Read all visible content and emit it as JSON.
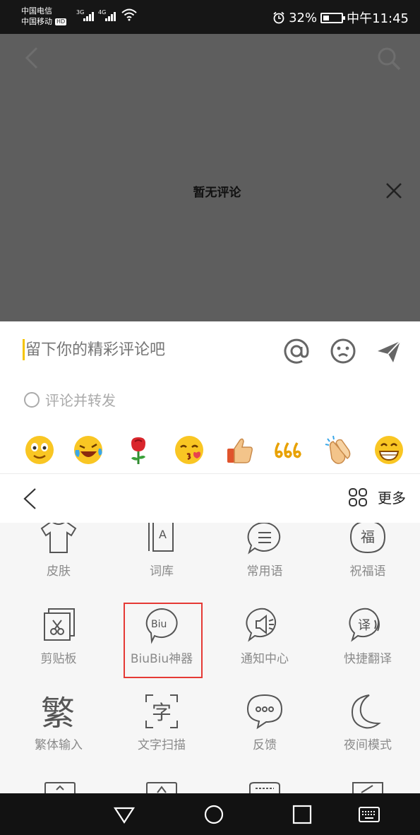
{
  "status_bar": {
    "carrier_1": "中国电信",
    "carrier_2": "中国移动",
    "hd_badge": "HD",
    "network_1": "3G",
    "network_2": "4G",
    "battery_text": "32%",
    "battery_level": 0.32,
    "time": "中午11:45"
  },
  "overlay": {
    "empty_message": "暂无评论"
  },
  "comment_box": {
    "placeholder": "留下你的精彩评论吧",
    "repost_label": "评论并转发",
    "emojis": [
      "smile-emoji",
      "laugh-cry-emoji",
      "rose-emoji",
      "kiss-emoji",
      "thumbs-up-emoji",
      "666-emoji",
      "clapping-emoji",
      "grin-emoji"
    ]
  },
  "keyboard_toolbar": {
    "more_label": "更多"
  },
  "tools": [
    {
      "label": "皮肤",
      "icon": "shirt-icon"
    },
    {
      "label": "词库",
      "icon": "dictionary-icon"
    },
    {
      "label": "常用语",
      "icon": "phrases-icon"
    },
    {
      "label": "祝福语",
      "icon": "blessing-icon"
    },
    {
      "label": "剪贴板",
      "icon": "clipboard-icon"
    },
    {
      "label": "BiuBiu神器",
      "icon": "biu-icon"
    },
    {
      "label": "通知中心",
      "icon": "notification-icon"
    },
    {
      "label": "快捷翻译",
      "icon": "translate-icon"
    },
    {
      "label": "繁体输入",
      "icon": "traditional-icon"
    },
    {
      "label": "文字扫描",
      "icon": "scan-text-icon"
    },
    {
      "label": "反馈",
      "icon": "feedback-icon"
    },
    {
      "label": "夜间模式",
      "icon": "night-mode-icon"
    }
  ],
  "tool_icon_text": {
    "dictionary": "A",
    "blessing": "福",
    "biu": "Biu",
    "translate": "译",
    "traditional": "繁",
    "scan": "字"
  },
  "colors": {
    "dim_overlay": "#5e5e5e",
    "caret": "#f5c400",
    "highlight_border": "#e53935"
  }
}
